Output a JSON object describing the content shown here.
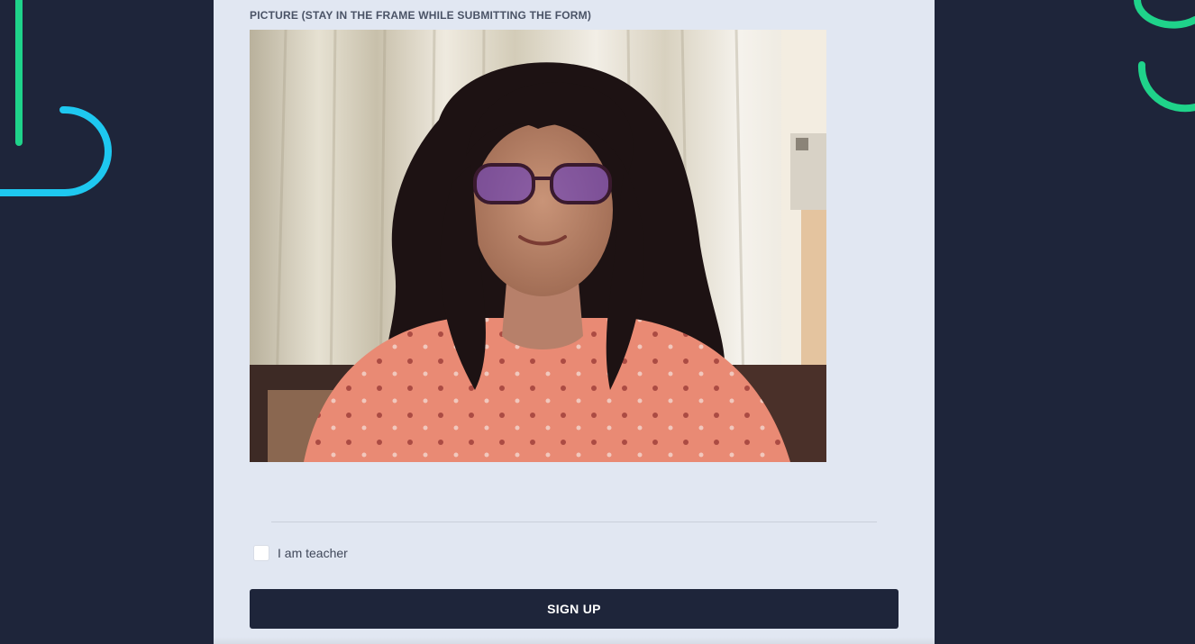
{
  "form": {
    "picture_label": "PICTURE (STAY IN THE FRAME WHILE SUBMITTING THE FORM)",
    "teacher_checkbox": {
      "label": "I am teacher",
      "checked": false
    },
    "signup_label": "SIGN UP"
  },
  "webcam": {
    "icon": "webcam-photo-person"
  },
  "colors": {
    "page_background": "#1e253a",
    "card_background": "#e1e7f2",
    "button_background": "#1e253a",
    "decor_green": "#1fd38a",
    "decor_cyan": "#1ec8f0"
  }
}
